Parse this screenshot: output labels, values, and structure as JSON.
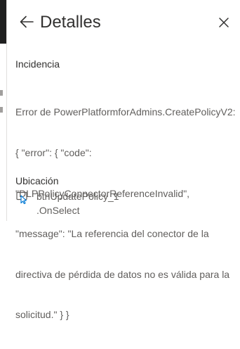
{
  "panel": {
    "title": "Detalles",
    "back_icon": "back-arrow-icon",
    "close_icon": "close-icon"
  },
  "issue": {
    "label": "Incidencia",
    "message_lines": [
      "Error de PowerPlatformforAdmins.CreatePolicyV2:",
      "{ \"error\": { \"code\":",
      "\"DLPPolicyConnectorReferenceInvalid\",",
      "\"message\": \"La referencia del conector de la",
      "directiva de pérdida de datos no es válida para la",
      "solicitud.\" } }"
    ]
  },
  "location": {
    "label": "Ubicación",
    "icon": "control-cursor-icon",
    "control": "btnUpdatePolicy_1",
    "property": ".OnSelect"
  },
  "colors": {
    "text_primary": "#323130",
    "text_secondary": "#605e5c",
    "icon_accent": "#0078d4"
  }
}
